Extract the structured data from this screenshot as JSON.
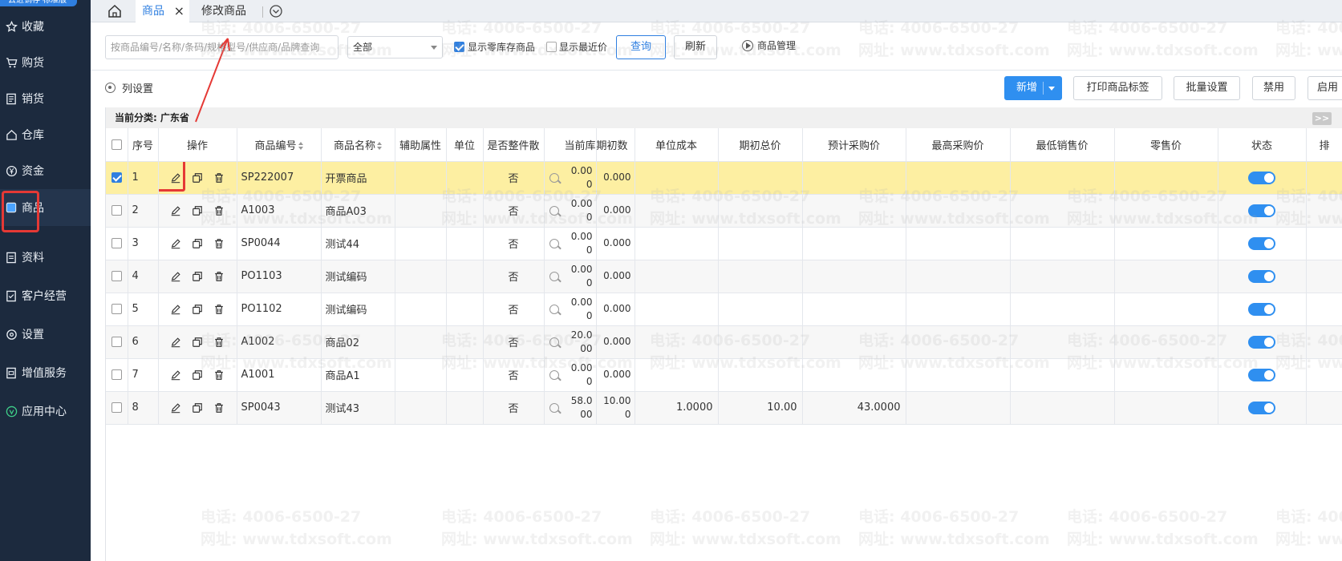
{
  "sidebar": {
    "brand": "云进销存·标准版",
    "items": [
      {
        "label": "收藏",
        "icon": "star-icon"
      },
      {
        "label": "购货",
        "icon": "cart-icon"
      },
      {
        "label": "销货",
        "icon": "document-icon"
      },
      {
        "label": "仓库",
        "icon": "house-icon"
      },
      {
        "label": "资金",
        "icon": "yen-coin-icon"
      },
      {
        "label": "商品",
        "icon": "box-icon"
      },
      {
        "label": "资料",
        "icon": "file-icon"
      },
      {
        "label": "客户经营",
        "icon": "checklist-icon"
      },
      {
        "label": "设置",
        "icon": "gear-icon"
      },
      {
        "label": "增值服务",
        "icon": "package-icon"
      },
      {
        "label": "应用中心",
        "icon": "app-circle-icon"
      }
    ]
  },
  "tabs": {
    "active": "商品",
    "other": "修改商品"
  },
  "toolbar": {
    "search_placeholder": "按商品编号/名称/条码/规格型号/供应商/品牌查询",
    "category_select": "全部",
    "show_zero_stock": "显示零库存商品",
    "show_recent_price": "显示最近价",
    "query_btn": "查询",
    "refresh_btn": "刷新",
    "manage_link": "商品管理"
  },
  "actions": {
    "column_settings": "列设置",
    "add": "新增",
    "print_labels": "打印商品标签",
    "batch_settings": "批量设置",
    "disable": "禁用",
    "enable": "启用"
  },
  "category_bar": {
    "label": "当前分类:",
    "value": "广东省",
    "collapse": ">>"
  },
  "table": {
    "headers": [
      "序号",
      "操作",
      "商品编号",
      "商品名称",
      "辅助属性",
      "单位",
      "是否整件散",
      "当前库",
      "期初数",
      "单位成本",
      "期初总价",
      "预计采购价",
      "最高采购价",
      "最低销售价",
      "零售价",
      "状态",
      "排"
    ],
    "rows": [
      {
        "no": "1",
        "code": "SP222007",
        "name": "开票商品",
        "whole": "否",
        "stock1": "0.00",
        "stock2": "0",
        "init1": "0.000",
        "init2": "",
        "unit_cost": "",
        "init_total": "",
        "est_purchase": "",
        "selected": true
      },
      {
        "no": "2",
        "code": "A1003",
        "name": "商品A03",
        "whole": "否",
        "stock1": "0.00",
        "stock2": "0",
        "init1": "0.000",
        "init2": "",
        "unit_cost": "",
        "init_total": "",
        "est_purchase": "",
        "selected": false
      },
      {
        "no": "3",
        "code": "SP0044",
        "name": "测试44",
        "whole": "否",
        "stock1": "0.00",
        "stock2": "0",
        "init1": "0.000",
        "init2": "",
        "unit_cost": "",
        "init_total": "",
        "est_purchase": "",
        "selected": false
      },
      {
        "no": "4",
        "code": "PO1103",
        "name": "测试编码",
        "whole": "否",
        "stock1": "0.00",
        "stock2": "0",
        "init1": "0.000",
        "init2": "",
        "unit_cost": "",
        "init_total": "",
        "est_purchase": "",
        "selected": false
      },
      {
        "no": "5",
        "code": "PO1102",
        "name": "测试编码",
        "whole": "否",
        "stock1": "0.00",
        "stock2": "0",
        "init1": "0.000",
        "init2": "",
        "unit_cost": "",
        "init_total": "",
        "est_purchase": "",
        "selected": false
      },
      {
        "no": "6",
        "code": "A1002",
        "name": "商品02",
        "whole": "否",
        "stock1": "20.0",
        "stock2": "00",
        "init1": "0.000",
        "init2": "",
        "unit_cost": "",
        "init_total": "",
        "est_purchase": "",
        "selected": false
      },
      {
        "no": "7",
        "code": "A1001",
        "name": "商品A1",
        "whole": "否",
        "stock1": "0.00",
        "stock2": "0",
        "init1": "0.000",
        "init2": "",
        "unit_cost": "",
        "init_total": "",
        "est_purchase": "",
        "selected": false
      },
      {
        "no": "8",
        "code": "SP0043",
        "name": "测试43",
        "whole": "否",
        "stock1": "58.0",
        "stock2": "00",
        "init1": "10.00",
        "init2": "0",
        "unit_cost": "1.0000",
        "init_total": "10.00",
        "est_purchase": "43.0000",
        "selected": false
      }
    ]
  },
  "watermark": {
    "phone": "电话: 4006-6500-27",
    "site": "网址: www.tdxsoft.com"
  },
  "colors": {
    "sidebar_bg": "#1c2a3e",
    "accent": "#2f8ff0",
    "selected_row": "#fdefa2",
    "highlight": "#e53935"
  }
}
